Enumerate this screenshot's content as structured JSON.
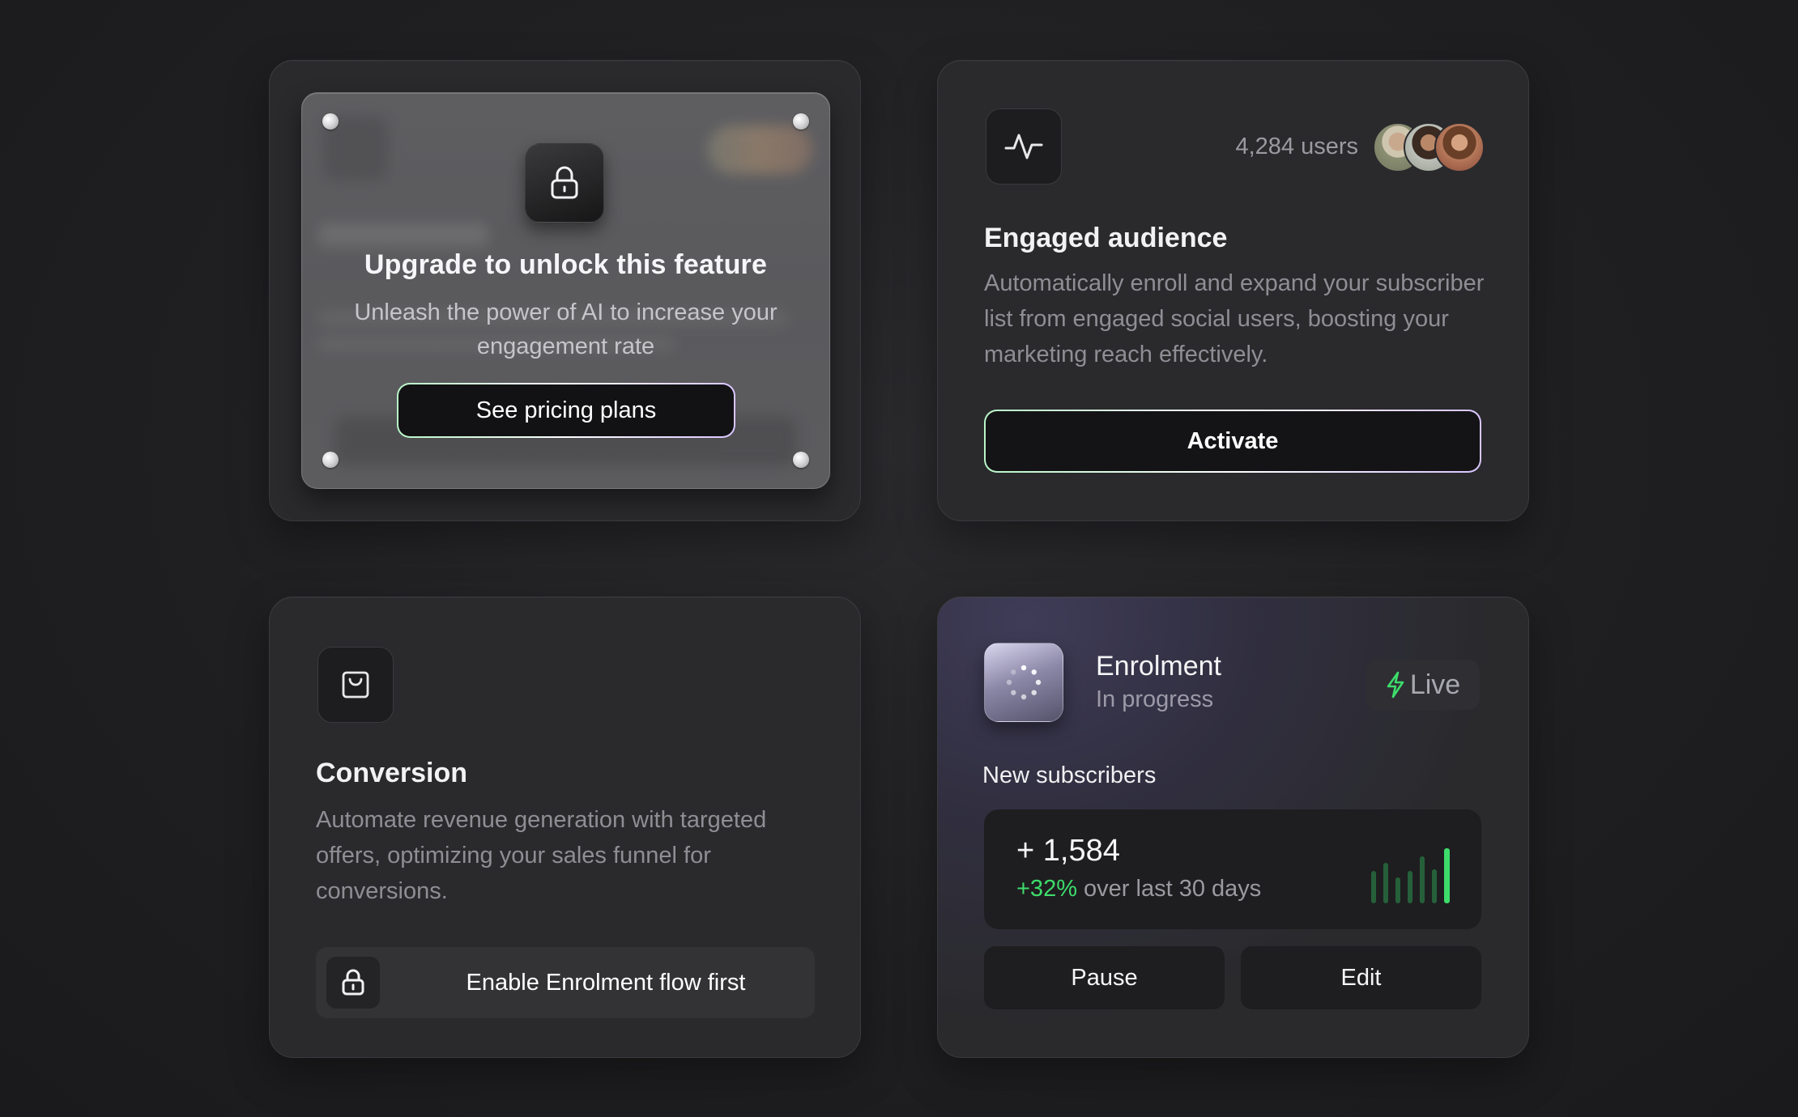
{
  "upgrade_card": {
    "title": "Upgrade to unlock this feature",
    "subtitle": "Unleash the power of AI to increase your engagement rate",
    "button_label": "See pricing plans",
    "icon": "lock-icon"
  },
  "engaged_card": {
    "icon": "activity-icon",
    "users_count": "4,284 users",
    "avatars": [
      "avatar-1",
      "avatar-2",
      "avatar-3"
    ],
    "title": "Engaged audience",
    "description": "Automatically enroll and expand your subscriber list from engaged social users, boosting your marketing reach effectively.",
    "button_label": "Activate"
  },
  "conversion_card": {
    "icon": "shopping-bag-icon",
    "title": "Conversion",
    "description": "Automate revenue generation with targeted offers, optimizing your sales funnel for conversions.",
    "button_label": "Enable Enrolment flow first"
  },
  "enrolment_card": {
    "title": "Enrolment",
    "status": "In progress",
    "live_label": "Live",
    "section_label": "New subscribers",
    "stat_value": "+ 1,584",
    "stat_delta_pct": "+32%",
    "stat_delta_text": "over last 30 days",
    "bar_levels": [
      0.5,
      0.62,
      0.4,
      0.5,
      0.72,
      0.52,
      0.85
    ],
    "pause_label": "Pause",
    "edit_label": "Edit"
  },
  "colors": {
    "accent_green": "#3ddc6b",
    "background": "#1f1f21",
    "card": "#2a2a2d"
  }
}
